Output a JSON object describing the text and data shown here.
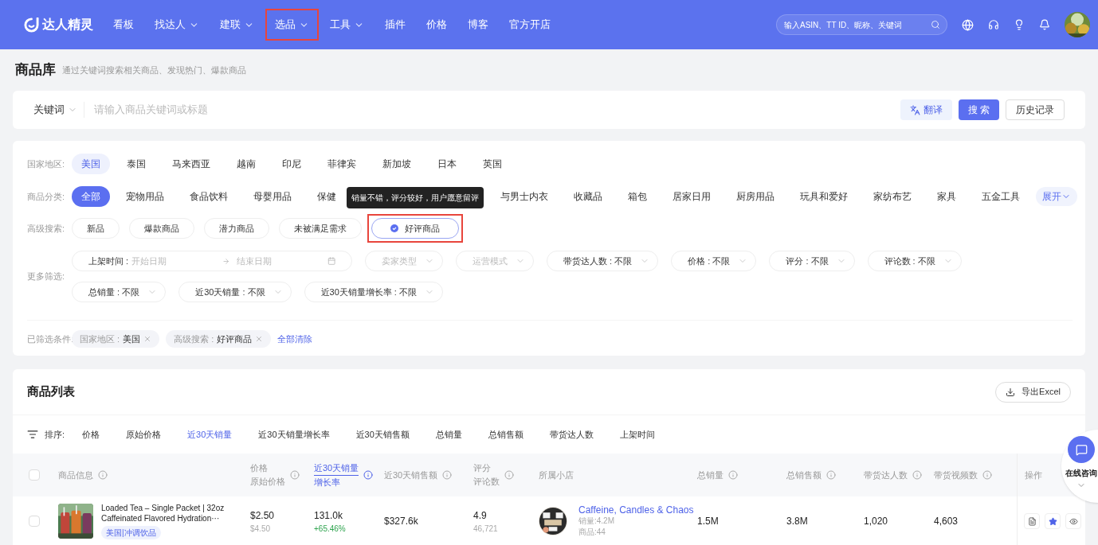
{
  "navbar": {
    "logo": "达人精灵",
    "items": [
      {
        "label": "看板",
        "dropdown": false,
        "highlighted": false
      },
      {
        "label": "找达人",
        "dropdown": true,
        "highlighted": false
      },
      {
        "label": "建联",
        "dropdown": true,
        "highlighted": false
      },
      {
        "label": "选品",
        "dropdown": true,
        "highlighted": true
      },
      {
        "label": "工具",
        "dropdown": true,
        "highlighted": false
      },
      {
        "label": "插件",
        "dropdown": false,
        "highlighted": false
      },
      {
        "label": "价格",
        "dropdown": false,
        "highlighted": false
      },
      {
        "label": "博客",
        "dropdown": false,
        "highlighted": false
      },
      {
        "label": "官方开店",
        "dropdown": false,
        "highlighted": false
      }
    ],
    "search": {
      "placeholder": "输入ASIN、TT ID、昵称、关键词"
    }
  },
  "page": {
    "title": "商品库",
    "subtitle": "通过关键词搜索相关商品、发现热门、爆款商品"
  },
  "keyword_bar": {
    "type_select": "关键词",
    "placeholder": "请输入商品关键词或标题",
    "buttons": [
      {
        "kind": "translate",
        "label": "翻译"
      },
      {
        "kind": "primary",
        "label": "搜 索"
      },
      {
        "kind": "default",
        "label": "历史记录"
      }
    ]
  },
  "filters": {
    "country": {
      "label": "国家地区:",
      "options": [
        {
          "label": "美国",
          "selected": true
        },
        {
          "label": "泰国",
          "selected": false
        },
        {
          "label": "马来西亚",
          "selected": false
        },
        {
          "label": "越南",
          "selected": false
        },
        {
          "label": "印尼",
          "selected": false
        },
        {
          "label": "菲律宾",
          "selected": false
        },
        {
          "label": "新加坡",
          "selected": false
        },
        {
          "label": "日本",
          "selected": false
        },
        {
          "label": "英国",
          "selected": false
        }
      ]
    },
    "category": {
      "label": "商品分类:",
      "options": [
        {
          "label": "全部",
          "selected": true
        },
        {
          "label": "宠物用品",
          "selected": false
        },
        {
          "label": "食品饮料",
          "selected": false
        },
        {
          "label": "母婴用品",
          "selected": false
        },
        {
          "label": "保健",
          "selected": false
        },
        {
          "label": "与男士内衣",
          "selected": false,
          "partly_hidden": true
        },
        {
          "label": "收藏品",
          "selected": false
        },
        {
          "label": "箱包",
          "selected": false
        },
        {
          "label": "居家日用",
          "selected": false
        },
        {
          "label": "厨房用品",
          "selected": false
        },
        {
          "label": "玩具和爱好",
          "selected": false
        },
        {
          "label": "家纺布艺",
          "selected": false
        },
        {
          "label": "家具",
          "selected": false
        },
        {
          "label": "五金工具",
          "selected": false
        }
      ],
      "expand": "展开"
    },
    "advanced": {
      "label": "高级搜索:",
      "options": [
        {
          "label": "新品",
          "selected": false,
          "highlighted": false
        },
        {
          "label": "爆款商品",
          "selected": false,
          "highlighted": false
        },
        {
          "label": "潜力商品",
          "selected": false,
          "highlighted": false
        },
        {
          "label": "未被满足需求",
          "selected": false,
          "highlighted": false
        },
        {
          "label": "好评商品",
          "selected": true,
          "highlighted": true,
          "tooltip": "销量不错，评分较好，用户愿意留评"
        }
      ]
    },
    "more": {
      "label": "更多筛选:",
      "fields": [
        {
          "kind": "date-range",
          "label": "上架时间 :",
          "start_placeholder": "开始日期",
          "end_placeholder": "结束日期"
        },
        {
          "kind": "select",
          "placeholder": "卖家类型"
        },
        {
          "kind": "select",
          "placeholder": "运营模式"
        },
        {
          "kind": "select",
          "value": "带货达人数 : 不限"
        },
        {
          "kind": "select",
          "value": "价格 : 不限"
        },
        {
          "kind": "select",
          "value": "评分 : 不限"
        },
        {
          "kind": "select",
          "value": "评论数 : 不限"
        },
        {
          "kind": "select",
          "value": "总销量 : 不限"
        },
        {
          "kind": "select",
          "value": "近30天销量 : 不限"
        },
        {
          "kind": "select",
          "value": "近30天销量增长率 : 不限"
        }
      ]
    },
    "applied": {
      "label": "已筛选条件:",
      "tags": [
        {
          "label": "国家地区 :",
          "value": "美国"
        },
        {
          "label": "高级搜索 :",
          "value": "好评商品"
        }
      ],
      "clear": "全部清除"
    }
  },
  "product_list": {
    "title": "商品列表",
    "export": "导出Excel",
    "all_checked": false,
    "sort": {
      "label": "排序:",
      "options": [
        {
          "label": "价格",
          "selected": false
        },
        {
          "label": "原始价格",
          "selected": false
        },
        {
          "label": "近30天销量",
          "selected": true
        },
        {
          "label": "近30天销量增长率",
          "selected": false
        },
        {
          "label": "近30天销售额",
          "selected": false
        },
        {
          "label": "总销量",
          "selected": false
        },
        {
          "label": "总销售额",
          "selected": false
        },
        {
          "label": "带货达人数",
          "selected": false
        },
        {
          "label": "上架时间",
          "selected": false
        }
      ]
    },
    "columns": [
      {
        "lines": [
          "商品信息"
        ],
        "info": true,
        "selected": false
      },
      {
        "lines": [
          "价格",
          "原始价格"
        ],
        "info": true,
        "selected": false
      },
      {
        "lines": [
          "近30天销量",
          "增长率"
        ],
        "info": true,
        "selected": true
      },
      {
        "lines": [
          "近30天销售额"
        ],
        "info": true,
        "selected": false
      },
      {
        "lines": [
          "评分",
          "评论数"
        ],
        "info": true,
        "selected": false
      },
      {
        "lines": [
          "所属小店"
        ],
        "info": false,
        "selected": false
      },
      {
        "lines": [
          "总销量"
        ],
        "info": true,
        "selected": false
      },
      {
        "lines": [
          "总销售额"
        ],
        "info": true,
        "selected": false
      },
      {
        "lines": [
          "带货达人数"
        ],
        "info": true,
        "selected": false
      },
      {
        "lines": [
          "带货视频数"
        ],
        "info": true,
        "selected": false
      },
      {
        "lines": [
          "操作"
        ],
        "info": false,
        "selected": false
      }
    ],
    "rows": [
      {
        "checked": false,
        "title_lines": [
          "Loaded Tea – Single Packet | 32oz",
          "Caffeinated Flavored Hydration···"
        ],
        "tag": "美国|冲调饮品",
        "price": "$2.50",
        "original_price": "$4.50",
        "sales_30d": "131.0k",
        "growth": "+65.46%",
        "revenue_30d": "$327.6k",
        "rating": "4.9",
        "reviews": "46,721",
        "shop": {
          "name": "Caffeine, Candles & Chaos",
          "sales": "销量:4.2M",
          "products": "商品:44"
        },
        "total_sales": "1.5M",
        "total_revenue": "3.8M",
        "creators": "1,020",
        "videos": "4,603",
        "favorited": true
      }
    ]
  },
  "chat_widget": {
    "label": "在线咨询"
  }
}
